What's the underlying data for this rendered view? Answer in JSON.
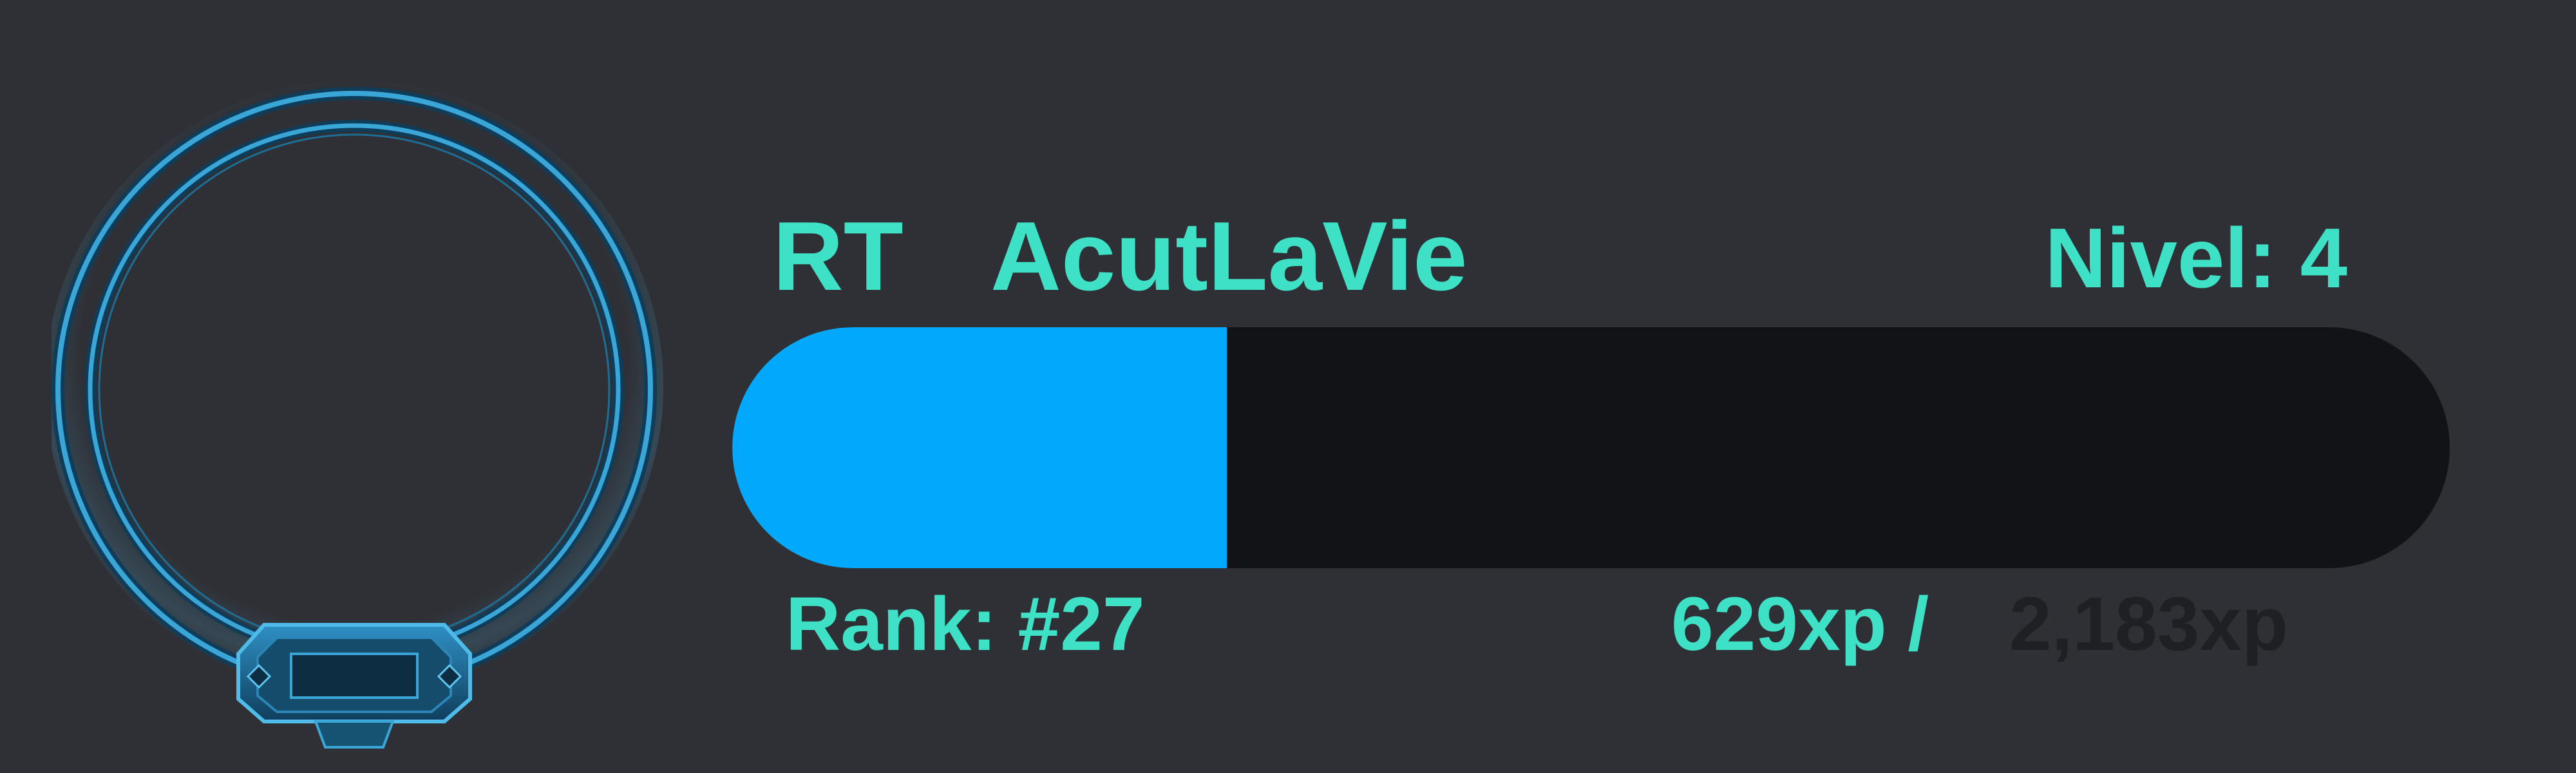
{
  "colors": {
    "background": "#2e3035",
    "accent_text": "#3ee0c6",
    "progress_fill": "#02a8fb",
    "progress_track": "#121316",
    "muted_text": "#1f2023",
    "frame_blue": "#3aa6d8"
  },
  "profile": {
    "name_prefix": "RT",
    "username": "AcutLaVie",
    "level_text": "Nivel: 4",
    "rank_text": "Rank: #27",
    "avatar_icon": "ring-frame-icon"
  },
  "progress": {
    "current_xp_text": "629xp /",
    "total_xp_text": "2,183xp",
    "fraction": 0.288
  }
}
